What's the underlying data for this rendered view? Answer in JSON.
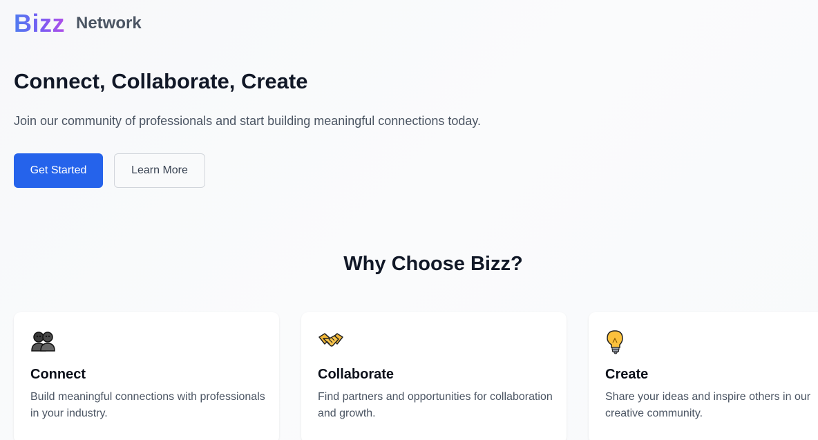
{
  "header": {
    "logo": "Bizz",
    "subtitle": "Network"
  },
  "hero": {
    "title": "Connect, Collaborate, Create",
    "subtitle": "Join our community of professionals and start building meaningful connections today.",
    "primary_button": "Get Started",
    "secondary_button": "Learn More"
  },
  "features": {
    "title": "Why Choose Bizz?",
    "cards": [
      {
        "icon": "people-icon",
        "title": "Connect",
        "text": "Build meaningful connections with professionals in your industry."
      },
      {
        "icon": "handshake-icon",
        "title": "Collaborate",
        "text": "Find partners and opportunities for collaboration and growth."
      },
      {
        "icon": "lightbulb-icon",
        "title": "Create",
        "text": "Share your ideas and inspire others in our creative community."
      }
    ]
  },
  "colors": {
    "primary": "#2563eb",
    "logo_gradient_start": "#4f7cf0",
    "logo_gradient_end": "#b14ee8",
    "heading": "#111827",
    "body_text": "#4b5563"
  }
}
